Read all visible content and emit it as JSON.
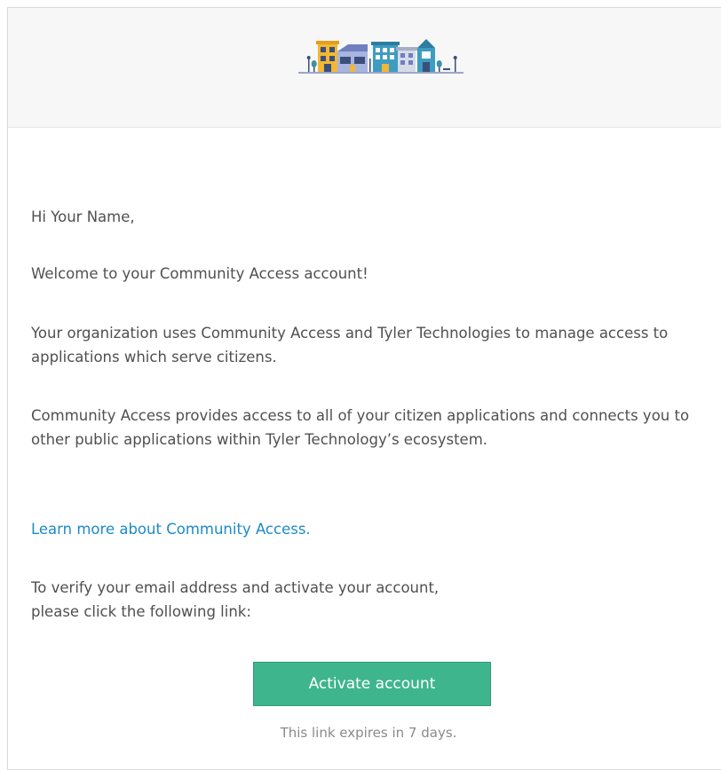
{
  "greeting": "Hi Your Name,",
  "welcome": "Welcome to your Community Access account!",
  "org_text": "Your organization uses Community Access and Tyler Technologies to manage access to applications which serve citizens.",
  "provides_text": "Community Access provides access to all of your citizen applications and connects you to other public applications within Tyler Technology’s ecosystem.",
  "learn_more_link": "Learn more about Community Access.",
  "verify_line1": "To verify your email address and activate your account,",
  "verify_line2": "please click the following link:",
  "activate_button": "Activate account",
  "expires_note": "This link expires in 7 days.",
  "colors": {
    "button": "#3fb58e",
    "link": "#1d8ac9",
    "header_bg": "#f7f7f7"
  },
  "logo_icon": "town-buildings-icon"
}
